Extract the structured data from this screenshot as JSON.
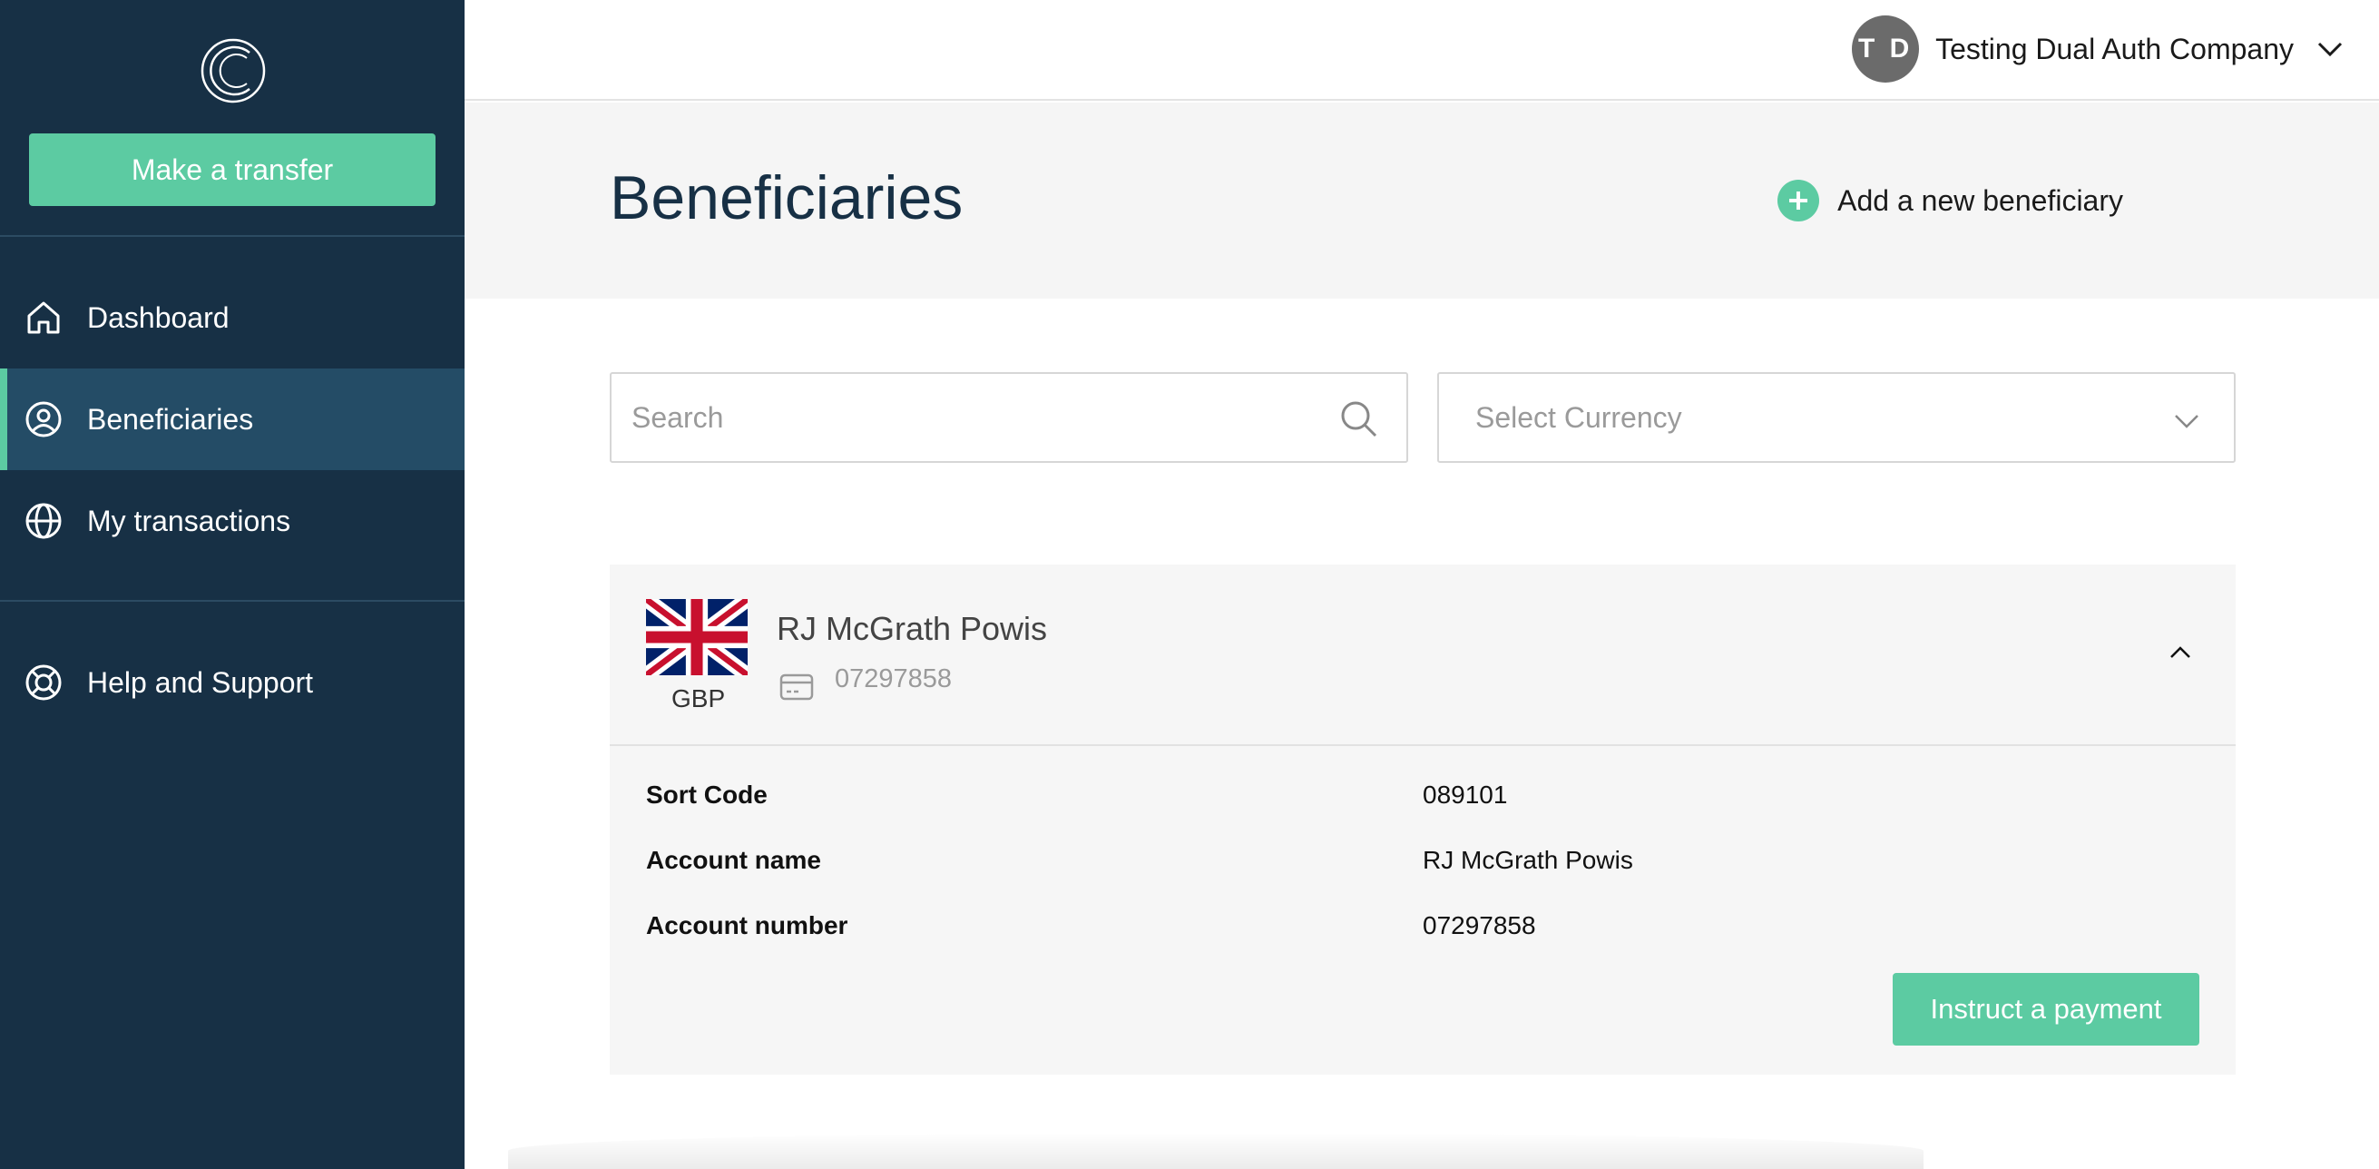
{
  "sidebar": {
    "logo": "currencycloud-logo",
    "transfer_button": "Make a transfer",
    "items": [
      {
        "label": "Dashboard",
        "icon": "home-icon",
        "active": false
      },
      {
        "label": "Beneficiaries",
        "icon": "user-circle-icon",
        "active": true
      },
      {
        "label": "My transactions",
        "icon": "globe-icon",
        "active": false
      },
      {
        "label": "Help and Support",
        "icon": "lifebuoy-icon",
        "active": false
      }
    ]
  },
  "topbar": {
    "avatar_initials": "T D",
    "company_name": "Testing Dual Auth Company"
  },
  "header": {
    "title": "Beneficiaries",
    "add_label": "Add a new beneficiary"
  },
  "filters": {
    "search_placeholder": "Search",
    "search_value": "",
    "currency_placeholder": "Select Currency"
  },
  "beneficiary": {
    "currency": "GBP",
    "name": "RJ McGrath Powis",
    "account_number": "07297858",
    "details": [
      {
        "label": "Sort Code",
        "value": "089101"
      },
      {
        "label": "Account name",
        "value": "RJ McGrath Powis"
      },
      {
        "label": "Account number",
        "value": "07297858"
      }
    ],
    "action_label": "Instruct a payment"
  },
  "colors": {
    "sidebar_bg": "#173045",
    "sidebar_active": "#244c66",
    "accent": "#5ccba2"
  }
}
